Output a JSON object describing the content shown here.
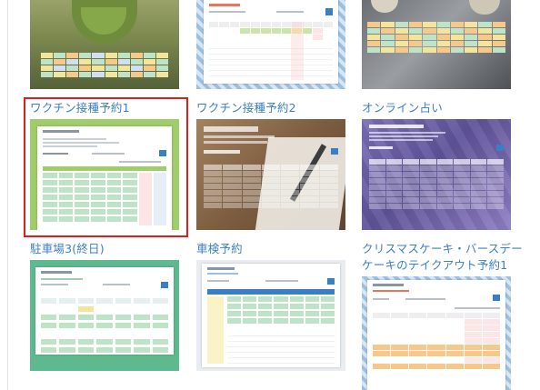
{
  "cards": [
    {
      "id": "top-left",
      "title": ""
    },
    {
      "id": "top-middle",
      "title": ""
    },
    {
      "id": "top-right",
      "title": ""
    },
    {
      "id": "vaccine-1",
      "title": "ワクチン接種予約1",
      "selected": true
    },
    {
      "id": "vaccine-2",
      "title": "ワクチン接種予約2",
      "selected": false
    },
    {
      "id": "online-fortune",
      "title": "オンライン占い",
      "selected": false
    },
    {
      "id": "parking-3",
      "title": "駐車場3(終日)",
      "selected": false
    },
    {
      "id": "car-inspection",
      "title": "車検予約",
      "selected": false
    },
    {
      "id": "christmas-cake",
      "title_line1": "クリスマスケーキ・バースデー",
      "title_line2": "ケーキのテイクアウト予約1",
      "selected": false
    }
  ],
  "colors": {
    "link": "#3a7fc4",
    "selected_border": "#d92020",
    "vaccine1_bg": "#9fcd6a",
    "parking_bg": "#5fb98e",
    "fortune_bg": "#6a5ea8",
    "wood_bg": "#8a6a4e",
    "gingham_bg": "#9cc1e0",
    "cell_green": "#bfe3c6",
    "cell_yellow": "#f3e59a",
    "cell_orange": "#f6c98a"
  }
}
